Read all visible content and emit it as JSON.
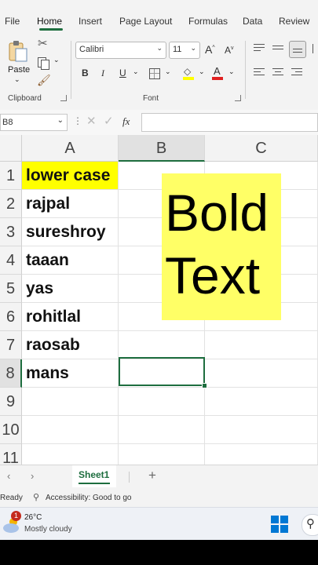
{
  "ribbon": {
    "tabs": [
      {
        "label": "File",
        "active": false
      },
      {
        "label": "Home",
        "active": true
      },
      {
        "label": "Insert",
        "active": false
      },
      {
        "label": "Page Layout",
        "active": false
      },
      {
        "label": "Formulas",
        "active": false
      },
      {
        "label": "Data",
        "active": false
      },
      {
        "label": "Review",
        "active": false
      }
    ],
    "clipboard": {
      "paste_label": "Paste",
      "group_label": "Clipboard"
    },
    "font": {
      "name": "Calibri",
      "size": "11",
      "group_label": "Font",
      "bold": "B",
      "italic": "I",
      "underline": "U",
      "grow": "A",
      "shrink": "A",
      "font_color_glyph": "A"
    }
  },
  "formula_bar": {
    "name_box": "B8",
    "fx": "fx",
    "value": ""
  },
  "grid": {
    "columns": [
      "A",
      "B",
      "C"
    ],
    "rows": [
      "1",
      "2",
      "3",
      "4",
      "5",
      "6",
      "7",
      "8",
      "9",
      "10",
      "11"
    ],
    "col_a": [
      "lower case",
      "rajpal",
      "sureshroy",
      "taaan",
      "yas",
      "rohitlal",
      "raosab",
      "mans"
    ],
    "header_fill": "#ffff00",
    "selected_cell": "B8",
    "textbox": {
      "line1": "Bold",
      "line2": "Text",
      "fill": "#ffff66"
    }
  },
  "sheets": {
    "tabs": [
      "Sheet1"
    ],
    "active": "Sheet1",
    "add_glyph": "+"
  },
  "status": {
    "ready": "Ready",
    "accessibility": "Accessibility: Good to go"
  },
  "taskbar": {
    "temperature": "26°C",
    "weather": "Mostly cloudy",
    "badge": "1"
  }
}
